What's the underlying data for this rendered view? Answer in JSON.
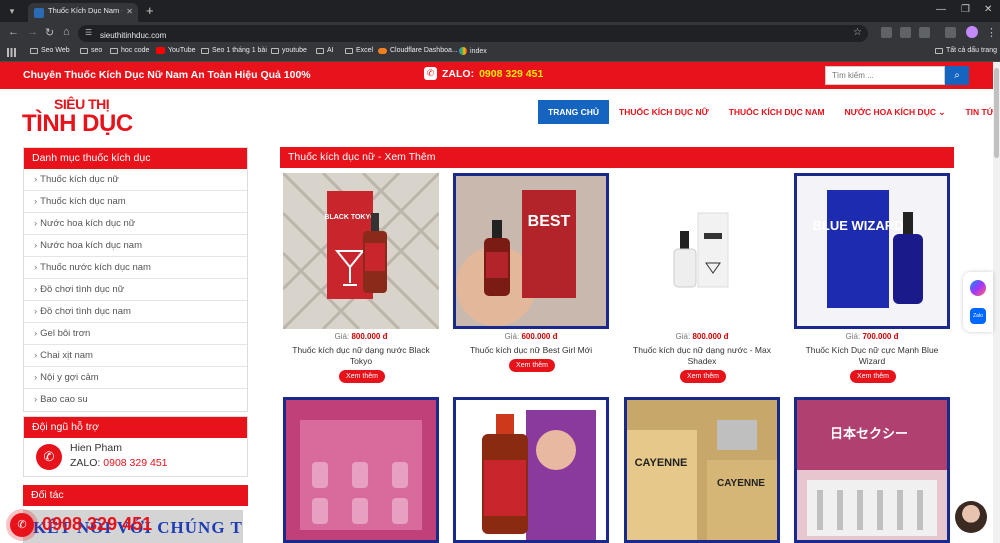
{
  "browser": {
    "tab_title": "Thuốc Kích Dục Nam - Nữ | Cu...",
    "url": "sieuthitinhduc.com",
    "bookmarks": [
      "Seo Web",
      "seo",
      "hoc code",
      "YouTube",
      "Seo 1 tháng 1 bài",
      "youtube",
      "AI",
      "Excel",
      "Cloudflare Dashboa...",
      "index"
    ],
    "all_bookmarks": "Tất cả dấu trang"
  },
  "topbar": {
    "slogan": "Chuyên Thuốc Kích Dục Nữ Nam An Toàn Hiệu Quả 100%",
    "zalo_label": "ZALO:",
    "zalo_phone": "0908 329 451",
    "search_placeholder": "Tìm kiếm ..."
  },
  "logo": {
    "top": "SIÊU THỊ",
    "bottom": "TÌNH DỤC"
  },
  "nav": [
    "TRANG CHỦ",
    "THUỐC KÍCH DỤC NỮ",
    "THUỐC KÍCH DỤC NAM",
    "NƯỚC HOA KÍCH DỤC ⌄",
    "TIN TỨC"
  ],
  "sidebar": {
    "category_title": "Danh mục thuốc kích dục",
    "categories": [
      "Thuốc kích dục nữ",
      "Thuốc kích dục nam",
      "Nước hoa kích dục nữ",
      "Nước hoa kích dục nam",
      "Thuốc nước kích dục nam",
      "Đồ chơi tình dục nữ",
      "Đồ chơi tình dục nam",
      "Gel bôi trơn",
      "Chai xịt nam",
      "Nội y gợi cảm",
      "Bao cao su"
    ],
    "support_title": "Đội ngũ hỗ trợ",
    "support_name": "Hien Pham",
    "support_phone_label": "ZALO:",
    "support_phone": "0908 329 451",
    "partner_title": "Đối tác",
    "partner_banner": "KẾT NỐI VỚI CHÚNG TÔI"
  },
  "content": {
    "section_title": "Thuốc kích dục nữ - Xem Thêm",
    "price_label": "Giá:",
    "button_label": "Xem thêm",
    "products": [
      {
        "name": "Thuốc kích dục nữ dạng nước Black Tokyo",
        "price": "800.000 đ"
      },
      {
        "name": "Thuốc kích dục nữ Best Girl Mới",
        "price": "600.000 đ"
      },
      {
        "name": "Thuốc kích dục nữ dạng nước - Max Shadex",
        "price": "800.000 đ"
      },
      {
        "name": "Thuốc Kích Dục nữ cực Mạnh Blue Wizard",
        "price": "700.000 đ"
      }
    ],
    "product_image_texts": [
      "BLACK TOKYO",
      "BEST",
      "",
      "BLUE WIZARD",
      "",
      "",
      "CAYENNE",
      "日本セクシー"
    ]
  },
  "floating": {
    "phone": "0908 329 451"
  }
}
